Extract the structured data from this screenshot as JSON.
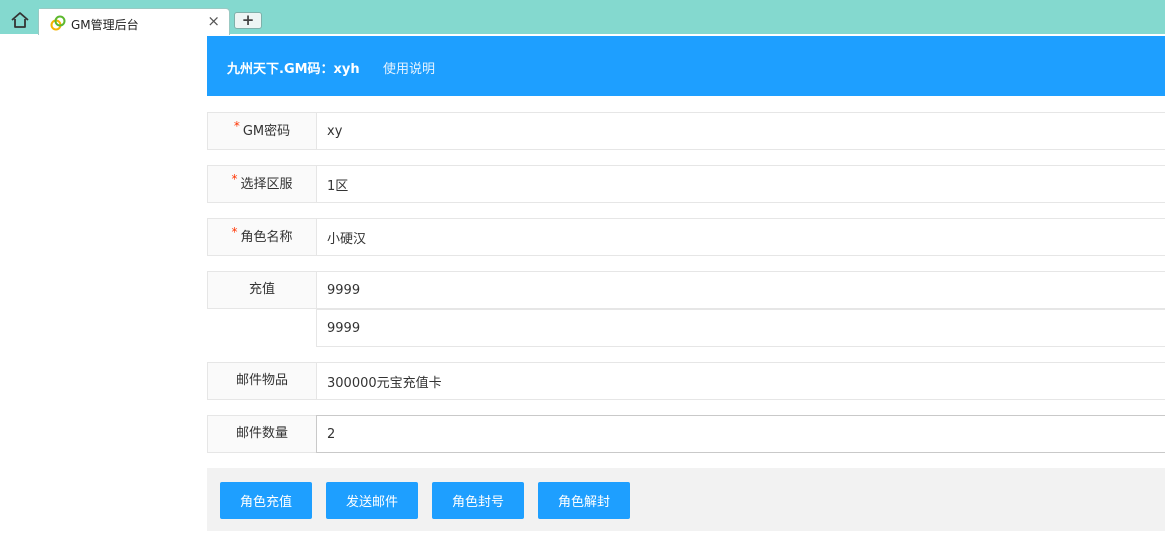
{
  "browser": {
    "tab_title": "GM管理后台",
    "close_glyph": "×",
    "newtab_glyph": "+"
  },
  "header": {
    "title": "九州天下.GM码：xyh",
    "link": "使用说明"
  },
  "form": {
    "required_mark": "*",
    "gm_password": {
      "label": "GM密码",
      "value": "xy"
    },
    "server": {
      "label": "选择区服",
      "value": "1区"
    },
    "role_name": {
      "label": "角色名称",
      "value": "小硬汉"
    },
    "recharge": {
      "label": "充值",
      "value": "9999",
      "value2": "9999"
    },
    "mail_item": {
      "label": "邮件物品",
      "value": "300000元宝充值卡"
    },
    "mail_qty": {
      "label": "邮件数量",
      "value": "2"
    }
  },
  "actions": {
    "recharge": "角色充值",
    "send_mail": "发送邮件",
    "ban": "角色封号",
    "unban": "角色解封"
  },
  "colors": {
    "accent": "#1e9fff",
    "tabstrip": "#84d9cf",
    "required": "#ff3300"
  }
}
